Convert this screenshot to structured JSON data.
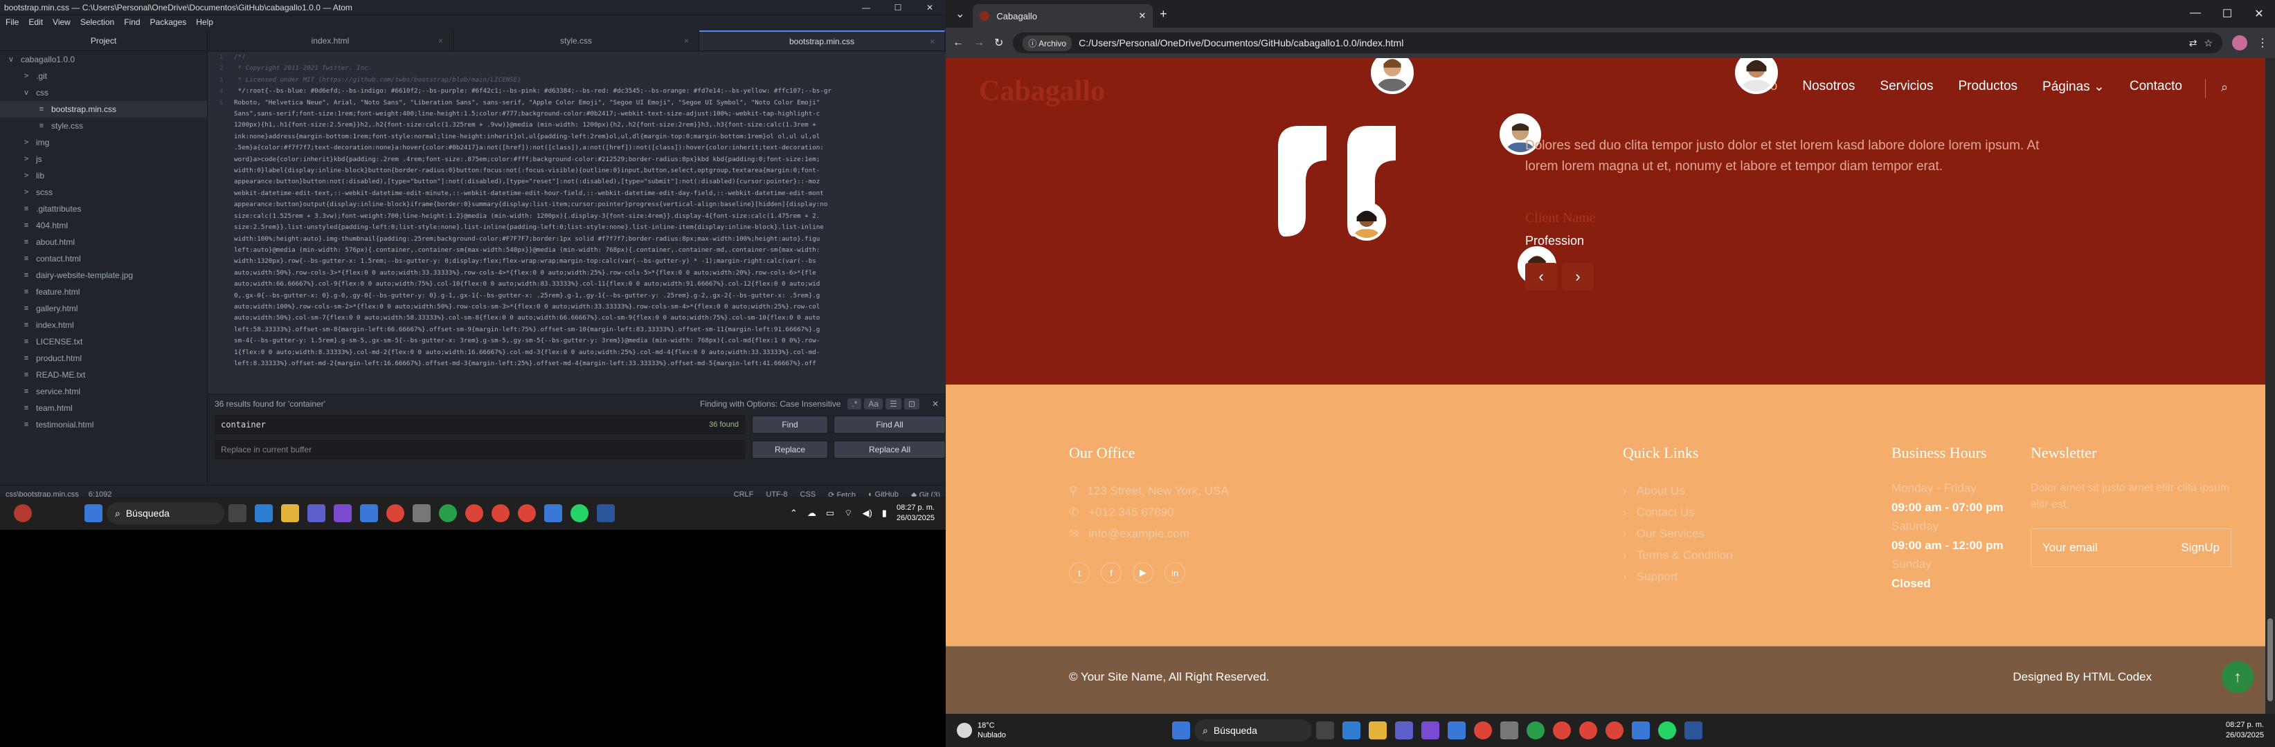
{
  "atom": {
    "title": "bootstrap.min.css — C:\\Users\\Personal\\OneDrive\\Documentos\\GitHub\\cabagallo1.0.0 — Atom",
    "menu": [
      "File",
      "Edit",
      "View",
      "Selection",
      "Find",
      "Packages",
      "Help"
    ],
    "tabs": [
      "index.html",
      "style.css",
      "bootstrap.min.css"
    ],
    "project_label": "Project",
    "tree": [
      {
        "label": "cabagallo1.0.0",
        "indent": 0,
        "icon": "v",
        "type": "root"
      },
      {
        "label": ".git",
        "indent": 1,
        "icon": ">",
        "type": "dir"
      },
      {
        "label": "css",
        "indent": 1,
        "icon": "v",
        "type": "dir"
      },
      {
        "label": "bootstrap.min.css",
        "indent": 2,
        "icon": "≡",
        "type": "file",
        "selected": true
      },
      {
        "label": "style.css",
        "indent": 2,
        "icon": "≡",
        "type": "file"
      },
      {
        "label": "img",
        "indent": 1,
        "icon": ">",
        "type": "dir"
      },
      {
        "label": "js",
        "indent": 1,
        "icon": ">",
        "type": "dir"
      },
      {
        "label": "lib",
        "indent": 1,
        "icon": ">",
        "type": "dir"
      },
      {
        "label": "scss",
        "indent": 1,
        "icon": ">",
        "type": "dir"
      },
      {
        "label": ".gitattributes",
        "indent": 1,
        "icon": "≡",
        "type": "file"
      },
      {
        "label": "404.html",
        "indent": 1,
        "icon": "≡",
        "type": "file"
      },
      {
        "label": "about.html",
        "indent": 1,
        "icon": "≡",
        "type": "file"
      },
      {
        "label": "contact.html",
        "indent": 1,
        "icon": "≡",
        "type": "file"
      },
      {
        "label": "dairy-website-template.jpg",
        "indent": 1,
        "icon": "≡",
        "type": "file"
      },
      {
        "label": "feature.html",
        "indent": 1,
        "icon": "≡",
        "type": "file"
      },
      {
        "label": "gallery.html",
        "indent": 1,
        "icon": "≡",
        "type": "file"
      },
      {
        "label": "index.html",
        "indent": 1,
        "icon": "≡",
        "type": "file"
      },
      {
        "label": "LICENSE.txt",
        "indent": 1,
        "icon": "≡",
        "type": "file"
      },
      {
        "label": "product.html",
        "indent": 1,
        "icon": "≡",
        "type": "file"
      },
      {
        "label": "READ-ME.txt",
        "indent": 1,
        "icon": "≡",
        "type": "file"
      },
      {
        "label": "service.html",
        "indent": 1,
        "icon": "≡",
        "type": "file"
      },
      {
        "label": "team.html",
        "indent": 1,
        "icon": "≡",
        "type": "file"
      },
      {
        "label": "testimonial.html",
        "indent": 1,
        "icon": "≡",
        "type": "file"
      }
    ],
    "code_lines": [
      "/*!",
      " * Copyright 2011-2021 Twitter, Inc.",
      " * Licensed under MIT (https://github.com/twbs/bootstrap/blob/main/LICENSE)",
      " */:root{--bs-blue: #0d6efd;--bs-indigo: #6610f2;--bs-purple: #6f42c1;--bs-pink: #d63384;--bs-red: #dc3545;--bs-orange: #fd7e14;--bs-yellow: #ffc107;--bs-gr",
      "Roboto, \"Helvetica Neue\", Arial, \"Noto Sans\", \"Liberation Sans\", sans-serif, \"Apple Color Emoji\", \"Segoe UI Emoji\", \"Segoe UI Symbol\", \"Noto Color Emoji\"",
      "Sans\",sans-serif;font-size:1rem;font-weight:400;line-height:1.5;color:#777;background-color:#0b2417;-webkit-text-size-adjust:100%;-webkit-tap-highlight-c",
      "1200px){h1,.h1{font-size:2.5rem}}h2,.h2{font-size:calc(1.325rem + .9vw)}@media (min-width: 1200px){h2,.h2{font-size:2rem}}h3,.h3{font-size:calc(1.3rem +",
      "ink:none}address{margin-bottom:1rem;font-style:normal;line-height:inherit}ol,ul{padding-left:2rem}ol,ul,dl{margin-top:0;margin-bottom:1rem}ol ol,ul ul,ol",
      ".5em}a{color:#f7f7f7;text-decoration:none}a:hover{color:#0b2417}a:not([href]):not([class]),a:not([href]):not([class]):hover{color:inherit;text-decoration:",
      "word}a>code{color:inherit}kbd{padding:.2rem .4rem;font-size:.875em;color:#fff;background-color:#212529;border-radius:8px}kbd kbd{padding:0;font-size:1em;",
      "width:0}label{display:inline-block}button{border-radius:0}button:focus:not(:focus-visible){outline:0}input,button,select,optgroup,textarea{margin:0;font-",
      "appearance:button}button:not(:disabled),[type=\"button\"]:not(:disabled),[type=\"reset\"]:not(:disabled),[type=\"submit\"]:not(:disabled){cursor:pointer}::-moz",
      "webkit-datetime-edit-text,::-webkit-datetime-edit-minute,::-webkit-datetime-edit-hour-field,::-webkit-datetime-edit-day-field,::-webkit-datetime-edit-mont",
      "appearance:button}output{display:inline-block}iframe{border:0}summary{display:list-item;cursor:pointer}progress{vertical-align:baseline}[hidden]{display:no",
      "size:calc(1.525rem + 3.3vw);font-weight:700;line-height:1.2}@media (min-width: 1200px){.display-3{font-size:4rem}}.display-4{font-size:calc(1.475rem + 2.",
      "size:2.5rem}}.list-unstyled{padding-left:0;list-style:none}.list-inline{padding-left:0;list-style:none}.list-inline-item{display:inline-block}.list-inline",
      "width:100%;height:auto}.img-thumbnail{padding:.25rem;background-color:#F7F7F7;border:1px solid #f7f7f7;border-radius:8px;max-width:100%;height:auto}.figu",
      "left:auto}@media (min-width: 576px){.container,.container-sm{max-width:540px}}@media (min-width: 768px){.container,.container-md,.container-sm{max-width:",
      "width:1320px}.row{--bs-gutter-x: 1.5rem;--bs-gutter-y: 0;display:flex;flex-wrap:wrap;margin-top:calc(var(--bs-gutter-y) * -1);margin-right:calc(var(--bs",
      "auto;width:50%}.row-cols-3>*{flex:0 0 auto;width:33.33333%}.row-cols-4>*{flex:0 0 auto;width:25%}.row-cols-5>*{flex:0 0 auto;width:20%}.row-cols-6>*{fle",
      "auto;width:66.66667%}.col-9{flex:0 0 auto;width:75%}.col-10{flex:0 0 auto;width:83.33333%}.col-11{flex:0 0 auto;width:91.66667%}.col-12{flex:0 0 auto;wid",
      "0,.gx-0{--bs-gutter-x: 0}.g-0,.gy-0{--bs-gutter-y: 0}.g-1,.gx-1{--bs-gutter-x: .25rem}.g-1,.gy-1{--bs-gutter-y: .25rem}.g-2,.gx-2{--bs-gutter-x: .5rem}.g",
      "auto;width:100%}.row-cols-sm-2>*{flex:0 0 auto;width:50%}.row-cols-sm-3>*{flex:0 0 auto;width:33.33333%}.row-cols-sm-4>*{flex:0 0 auto;width:25%}.row-col",
      "auto;width:50%}.col-sm-7{flex:0 0 auto;width:58.33333%}.col-sm-8{flex:0 0 auto;width:66.66667%}.col-sm-9{flex:0 0 auto;width:75%}.col-sm-10{flex:0 0 auto",
      "left:58.33333%}.offset-sm-8{margin-left:66.66667%}.offset-sm-9{margin-left:75%}.offset-sm-10{margin-left:83.33333%}.offset-sm-11{margin-left:91.66667%}.g",
      "sm-4{--bs-gutter-y: 1.5rem}.g-sm-5,.gx-sm-5{--bs-gutter-x: 3rem}.g-sm-5,.gy-sm-5{--bs-gutter-y: 3rem}}@media (min-width: 768px){.col-md{flex:1 0 0%}.row-",
      "1{flex:0 0 auto;width:8.33333%}.col-md-2{flex:0 0 auto;width:16.66667%}.col-md-3{flex:0 0 auto;width:25%}.col-md-4{flex:0 0 auto;width:33.33333%}.col-md-",
      "left:8.33333%}.offset-md-2{margin-left:16.66667%}.offset-md-3{margin-left:25%}.offset-md-4{margin-left:33.33333%}.offset-md-5{margin-left:41.66667%}.off"
    ],
    "line_numbers": [
      "1",
      "2",
      "3",
      "4",
      "5",
      "",
      "",
      "",
      "",
      "",
      "",
      "",
      "",
      "",
      "",
      "",
      "",
      "",
      "",
      "",
      "",
      "",
      "",
      "",
      "",
      "",
      "",
      "",
      "",
      ""
    ],
    "find": {
      "results": "36 results found for 'container'",
      "options": "Finding with Options: Case Insensitive",
      "query": "container",
      "count": "36 found",
      "find_btn": "Find",
      "find_all_btn": "Find All",
      "replace_placeholder": "Replace in current buffer",
      "replace_btn": "Replace",
      "replace_all_btn": "Replace All"
    },
    "status": {
      "left": "css\\bootstrap.min.css",
      "pos": "6:1092",
      "crlf": "CRLF",
      "enc": "UTF-8",
      "grammar": "CSS",
      "fetch": "Fetch",
      "github": "GitHub",
      "git": "Git (3)"
    }
  },
  "taskbar_left": {
    "search": "Búsqueda",
    "time": "08:27 p. m.",
    "date": "26/03/2025"
  },
  "browser": {
    "tab_title": "Cabagallo",
    "address_pill": "Archivo",
    "url": "C:/Users/Personal/OneDrive/Documentos/GitHub/cabagallo1.0.0/index.html"
  },
  "site": {
    "brand": "Cabagallo",
    "nav": [
      "Inicio",
      "Nosotros",
      "Servicios",
      "Productos",
      "Páginas",
      "Contacto"
    ],
    "testimonial": {
      "text": "Dolores sed duo clita tempor justo dolor et stet lorem kasd labore dolore lorem ipsum. At lorem lorem magna ut et, nonumy et labore et tempor diam tempor erat.",
      "name": "Client Name",
      "profession": "Profession"
    },
    "footer": {
      "office": {
        "title": "Our Office",
        "address": "123 Street, New York, USA",
        "phone": "+012 345 67890",
        "email": "info@example.com"
      },
      "links": {
        "title": "Quick Links",
        "items": [
          "About Us",
          "Contact Us",
          "Our Services",
          "Terms & Condition",
          "Support"
        ]
      },
      "hours": {
        "title": "Business Hours",
        "l1": "Monday - Friday",
        "v1": "09:00 am - 07:00 pm",
        "l2": "Saturday",
        "v2": "09:00 am - 12:00 pm",
        "l3": "Sunday",
        "v3": "Closed"
      },
      "newsletter": {
        "title": "Newsletter",
        "text": "Dolor amet sit justo amet elitr clita ipsum elitr est.",
        "placeholder": "Your email",
        "button": "SignUp"
      }
    },
    "copyright": "© Your Site Name, All Right Reserved.",
    "designed": "Designed By HTML Codex"
  },
  "taskbar_right": {
    "weather_temp": "18°C",
    "weather_desc": "Nublado",
    "search": "Búsqueda",
    "time": "08:27 p. m.",
    "date": "26/03/2025"
  }
}
